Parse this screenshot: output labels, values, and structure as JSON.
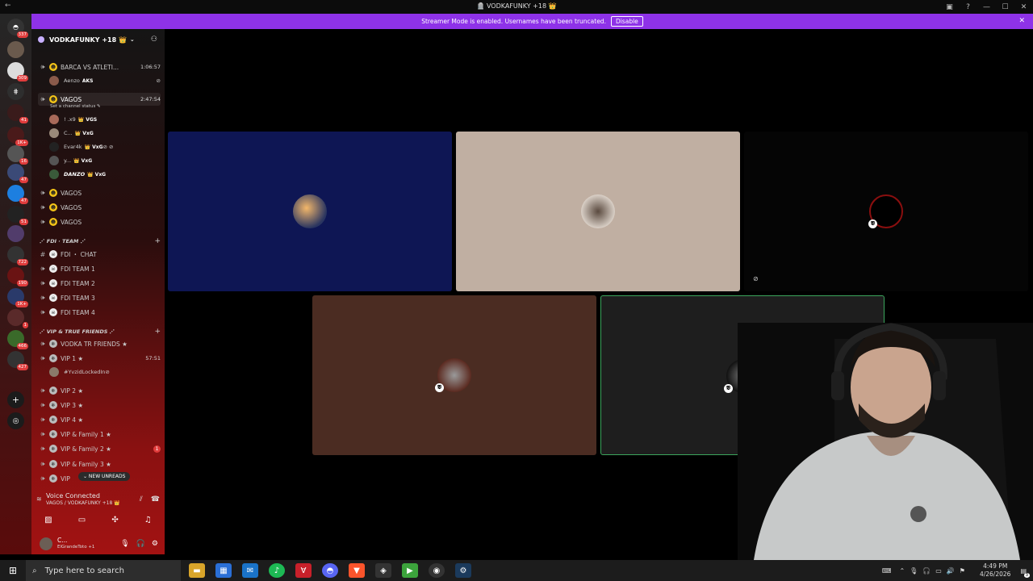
{
  "window": {
    "title": "🪦 VODKAFUNKY +18 👑",
    "back": "←"
  },
  "banner": {
    "text": "Streamer Mode is enabled. Usernames have been truncated.",
    "button": "Disable"
  },
  "guild_badges": [
    "337",
    "309",
    "41",
    "1K+",
    "16",
    "47",
    "47",
    "51",
    "722",
    "190",
    "1K+",
    "1",
    "466",
    "427"
  ],
  "server": {
    "name": "VODKAFUNKY +18 👑"
  },
  "channels": {
    "barca": {
      "name": "BARCA VS ATLETI...",
      "time": "1:06:57",
      "user": "Aenzo",
      "user_tag": "AKS"
    },
    "vagos_active": {
      "name": "VAGOS",
      "time": "2:47:54",
      "status": "Set a channel status ✎"
    },
    "vagos_users": [
      {
        "name": "! .x9",
        "tag": "👑 VGS"
      },
      {
        "name": "C...",
        "tag": "👑 VxG"
      },
      {
        "name": "Evar4k",
        "tag": "👑 VxG"
      },
      {
        "name": "y...",
        "tag": "👑 VxG"
      },
      {
        "name": "DANZO",
        "tag": "👑 VxG"
      }
    ],
    "vagos_more": [
      "VAGOS",
      "VAGOS",
      "VAGOS"
    ],
    "fdi_category": "⋰ FDI · TEAM ⋰",
    "fdi": [
      "FDI ・ CHAT",
      "FDI TEAM 1",
      "FDI TEAM 2",
      "FDI TEAM 3",
      "FDI TEAM 4"
    ],
    "vip_category": "⋰ VIP & TRUE FRIENDS ⋰",
    "vip": [
      {
        "name": "VODKA TR FRIENDS ★"
      },
      {
        "name": "VIP 1 ★",
        "time": "57:51"
      },
      {
        "name": "VIP 2 ★"
      },
      {
        "name": "VIP 3 ★"
      },
      {
        "name": "VIP 4 ★"
      },
      {
        "name": "VIP & Family 1 ★"
      },
      {
        "name": "VIP & Family 2 ★",
        "badge": "1"
      },
      {
        "name": "VIP & Family 3 ★"
      },
      {
        "name": "VIP"
      }
    ],
    "vip1_user": "#YvzidLockedIn"
  },
  "new_unreads": "⌄ NEW UNREADS",
  "voice": {
    "status": "Voice Connected",
    "channel": "VAGOS / VODKAFUNKY +18 👑"
  },
  "user": {
    "name": "C...",
    "sub": "ElGrandeToto +1"
  },
  "taskbar": {
    "search_placeholder": "Type here to search",
    "time": "4:49 PM",
    "date": "4/26/2026",
    "notif": "3"
  },
  "colors": {
    "banner": "#8e32e8",
    "tile1": "#0e1654",
    "tile2": "#c0afa2",
    "tile4": "#4b2c22",
    "tile5": "#1e1e1e",
    "speaking": "#3ba55c"
  }
}
